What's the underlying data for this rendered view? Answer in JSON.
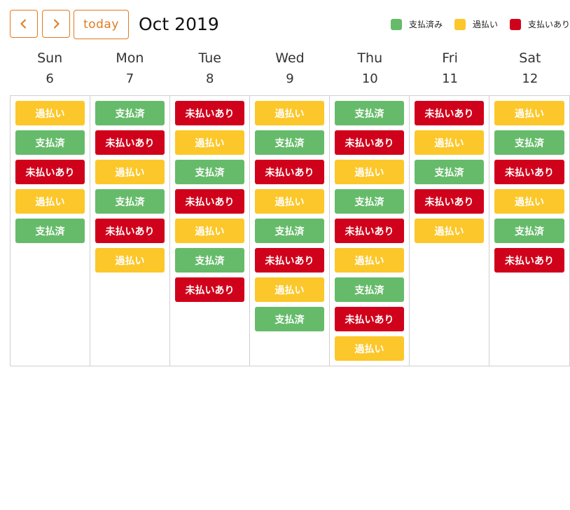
{
  "toolbar": {
    "prev_icon": "chevron-left-icon",
    "next_icon": "chevron-right-icon",
    "today_label": "today",
    "title": "Oct 2019"
  },
  "legend": [
    {
      "label": "支払済み",
      "color": "#66bb6a"
    },
    {
      "label": "過払い",
      "color": "#fcc72a"
    },
    {
      "label": "支払いあり",
      "color": "#d0021b"
    }
  ],
  "colors": {
    "accent": "#e07a1f",
    "paid": "#66bb6a",
    "overpaid": "#fcc72a",
    "unpaid": "#d0021b"
  },
  "days": [
    {
      "dow": "Sun",
      "date": "6",
      "events": [
        {
          "label": "過払い",
          "kind": "over"
        },
        {
          "label": "支払済",
          "kind": "paid"
        },
        {
          "label": "未払いあり",
          "kind": "unpaid"
        },
        {
          "label": "過払い",
          "kind": "over"
        },
        {
          "label": "支払済",
          "kind": "paid"
        }
      ]
    },
    {
      "dow": "Mon",
      "date": "7",
      "events": [
        {
          "label": "支払済",
          "kind": "paid"
        },
        {
          "label": "未払いあり",
          "kind": "unpaid"
        },
        {
          "label": "過払い",
          "kind": "over"
        },
        {
          "label": "支払済",
          "kind": "paid"
        },
        {
          "label": "未払いあり",
          "kind": "unpaid"
        },
        {
          "label": "過払い",
          "kind": "over"
        }
      ]
    },
    {
      "dow": "Tue",
      "date": "8",
      "events": [
        {
          "label": "未払いあり",
          "kind": "unpaid"
        },
        {
          "label": "過払い",
          "kind": "over"
        },
        {
          "label": "支払済",
          "kind": "paid"
        },
        {
          "label": "未払いあり",
          "kind": "unpaid"
        },
        {
          "label": "過払い",
          "kind": "over"
        },
        {
          "label": "支払済",
          "kind": "paid"
        },
        {
          "label": "未払いあり",
          "kind": "unpaid"
        }
      ]
    },
    {
      "dow": "Wed",
      "date": "9",
      "events": [
        {
          "label": "過払い",
          "kind": "over"
        },
        {
          "label": "支払済",
          "kind": "paid"
        },
        {
          "label": "未払いあり",
          "kind": "unpaid"
        },
        {
          "label": "過払い",
          "kind": "over"
        },
        {
          "label": "支払済",
          "kind": "paid"
        },
        {
          "label": "未払いあり",
          "kind": "unpaid"
        },
        {
          "label": "過払い",
          "kind": "over"
        },
        {
          "label": "支払済",
          "kind": "paid"
        }
      ]
    },
    {
      "dow": "Thu",
      "date": "10",
      "events": [
        {
          "label": "支払済",
          "kind": "paid"
        },
        {
          "label": "未払いあり",
          "kind": "unpaid"
        },
        {
          "label": "過払い",
          "kind": "over"
        },
        {
          "label": "支払済",
          "kind": "paid"
        },
        {
          "label": "未払いあり",
          "kind": "unpaid"
        },
        {
          "label": "過払い",
          "kind": "over"
        },
        {
          "label": "支払済",
          "kind": "paid"
        },
        {
          "label": "未払いあり",
          "kind": "unpaid"
        },
        {
          "label": "過払い",
          "kind": "over"
        }
      ]
    },
    {
      "dow": "Fri",
      "date": "11",
      "events": [
        {
          "label": "未払いあり",
          "kind": "unpaid"
        },
        {
          "label": "過払い",
          "kind": "over"
        },
        {
          "label": "支払済",
          "kind": "paid"
        },
        {
          "label": "未払いあり",
          "kind": "unpaid"
        },
        {
          "label": "過払い",
          "kind": "over"
        }
      ]
    },
    {
      "dow": "Sat",
      "date": "12",
      "events": [
        {
          "label": "過払い",
          "kind": "over"
        },
        {
          "label": "支払済",
          "kind": "paid"
        },
        {
          "label": "未払いあり",
          "kind": "unpaid"
        },
        {
          "label": "過払い",
          "kind": "over"
        },
        {
          "label": "支払済",
          "kind": "paid"
        },
        {
          "label": "未払いあり",
          "kind": "unpaid"
        }
      ]
    }
  ]
}
